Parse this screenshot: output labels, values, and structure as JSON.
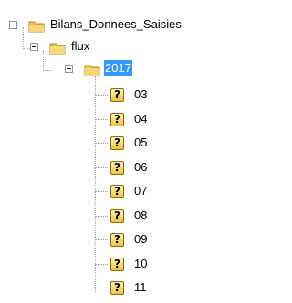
{
  "tree": {
    "root": {
      "label": "Bilans_Donnees_Saisies",
      "icon": "folder-icon",
      "expanded": true
    },
    "child": {
      "label": "flux",
      "icon": "folder-icon",
      "expanded": true
    },
    "selected_folder": {
      "label": "2017",
      "icon": "folder-icon",
      "expanded": true,
      "selected": true
    },
    "items": [
      {
        "label": "03",
        "icon": "unknown-file-icon"
      },
      {
        "label": "04",
        "icon": "unknown-file-icon"
      },
      {
        "label": "05",
        "icon": "unknown-file-icon"
      },
      {
        "label": "06",
        "icon": "unknown-file-icon"
      },
      {
        "label": "07",
        "icon": "unknown-file-icon"
      },
      {
        "label": "08",
        "icon": "unknown-file-icon"
      },
      {
        "label": "09",
        "icon": "unknown-file-icon"
      },
      {
        "label": "10",
        "icon": "unknown-file-icon"
      },
      {
        "label": "11",
        "icon": "unknown-file-icon"
      }
    ]
  },
  "colors": {
    "selection": "#3399ff",
    "folder": "#f3c24a"
  }
}
